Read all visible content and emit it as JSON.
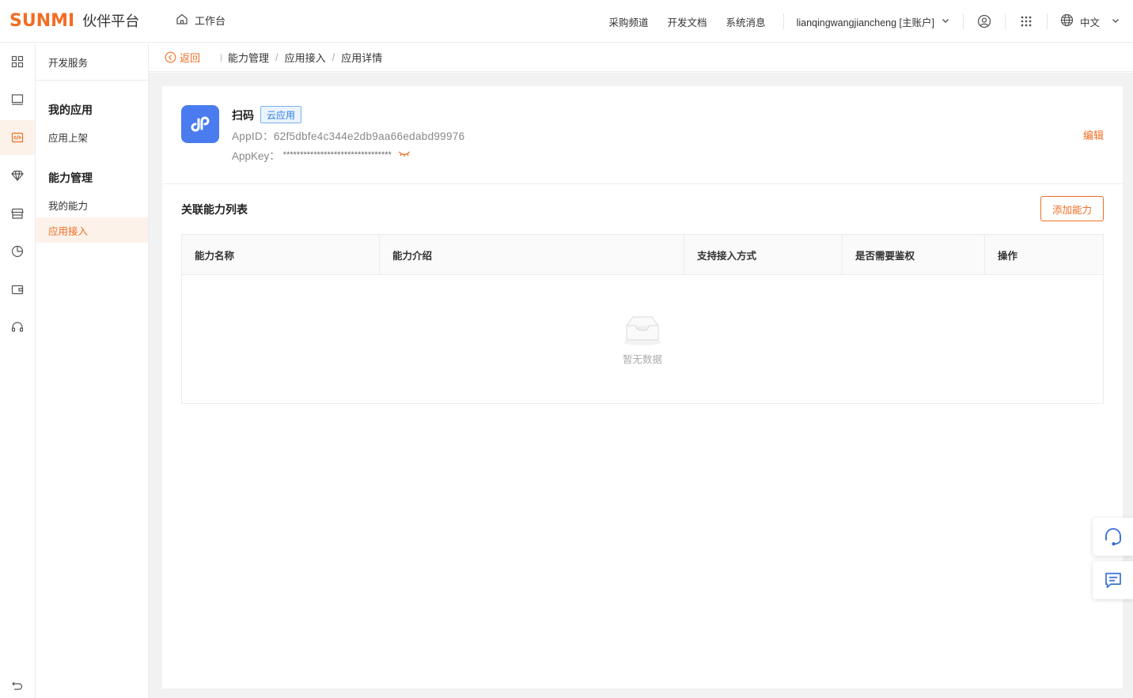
{
  "header": {
    "logo_word": "SUNMI",
    "logo_sub": "伙伴平台",
    "workbench": "工作台",
    "links": [
      "采购频道",
      "开发文档",
      "系统消息"
    ],
    "account": "lianqingwangjiancheng [主账户]",
    "language": "中文"
  },
  "rail": {
    "icons": [
      "grid-icon",
      "monitor-icon",
      "code-icon",
      "diamond-icon",
      "store-icon",
      "pie-chart-icon",
      "wallet-icon",
      "headset-icon"
    ],
    "active_index": 2
  },
  "sidebar": {
    "head": "开发服务",
    "group1": "我的应用",
    "group1_items": [
      "应用上架"
    ],
    "group2": "能力管理",
    "group2_items": [
      "我的能力",
      "应用接入"
    ],
    "active_item": "应用接入"
  },
  "breadcrumb": {
    "back": "返回",
    "items": [
      "能力管理",
      "应用接入",
      "应用详情"
    ]
  },
  "app": {
    "name": "扫码",
    "tag": "云应用",
    "appid_label": "AppID：",
    "appid": "62f5dbfe4c344e2db9aa66edabd99976",
    "appkey_label": "AppKey：",
    "appkey_mask": "********************************",
    "edit": "编辑"
  },
  "ability_list": {
    "title": "关联能力列表",
    "add_button": "添加能力",
    "columns": [
      "能力名称",
      "能力介绍",
      "支持接入方式",
      "是否需要鉴权",
      "操作"
    ],
    "rows": [],
    "empty_text": "暂无数据"
  },
  "colors": {
    "brand": "#f16d22",
    "app_icon": "#4a7cf0",
    "tag_blue": "#2f7de1",
    "float_icon": "#3b6fd8"
  }
}
